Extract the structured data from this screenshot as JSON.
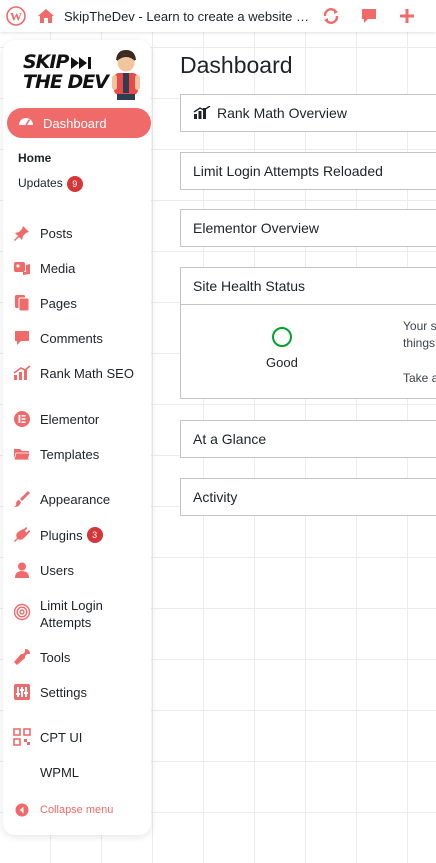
{
  "adminbar": {
    "site_title": "SkipTheDev - Learn to create a website e...",
    "accent_color": "#f06a6a"
  },
  "brand": {
    "logo_line1": "SKIP",
    "logo_line2": "THE DEV"
  },
  "sidebar": {
    "dashboard_label": "Dashboard",
    "submenu": {
      "home": "Home",
      "updates": "Updates",
      "updates_badge": "9"
    },
    "items": [
      {
        "label": "Posts",
        "icon": "pin-icon"
      },
      {
        "label": "Media",
        "icon": "media-icon"
      },
      {
        "label": "Pages",
        "icon": "pages-icon"
      },
      {
        "label": "Comments",
        "icon": "comment-icon"
      },
      {
        "label": "Rank Math SEO",
        "icon": "rank-math-icon"
      },
      {
        "label": "Elementor",
        "icon": "elementor-icon"
      },
      {
        "label": "Templates",
        "icon": "folder-icon"
      },
      {
        "label": "Appearance",
        "icon": "brush-icon"
      },
      {
        "label": "Plugins",
        "icon": "plug-icon",
        "badge": "3"
      },
      {
        "label": "Users",
        "icon": "user-icon"
      },
      {
        "label": "Limit Login Attempts",
        "icon": "fingerprint-icon"
      },
      {
        "label": "Tools",
        "icon": "wrench-icon"
      },
      {
        "label": "Settings",
        "icon": "settings-icon"
      },
      {
        "label": "CPT UI",
        "icon": "cpt-icon"
      },
      {
        "label": "WPML",
        "icon": "wpml-icon"
      }
    ],
    "collapse_label": "Collapse menu"
  },
  "main": {
    "title": "Dashboard",
    "widgets": {
      "rank_math": "Rank Math Overview",
      "limit_login": "Limit Login Attempts Reloaded",
      "elementor": "Elementor Overview",
      "site_health": "Site Health Status",
      "at_a_glance": "At a Glance",
      "activity": "Activity"
    },
    "site_health": {
      "status": "Good",
      "text_line1": "Your s",
      "text_line2": "things",
      "text_line3": "Take a"
    }
  },
  "colors": {
    "accent": "#f06a6a",
    "badge": "#d63638",
    "health_good": "#00a32a"
  }
}
